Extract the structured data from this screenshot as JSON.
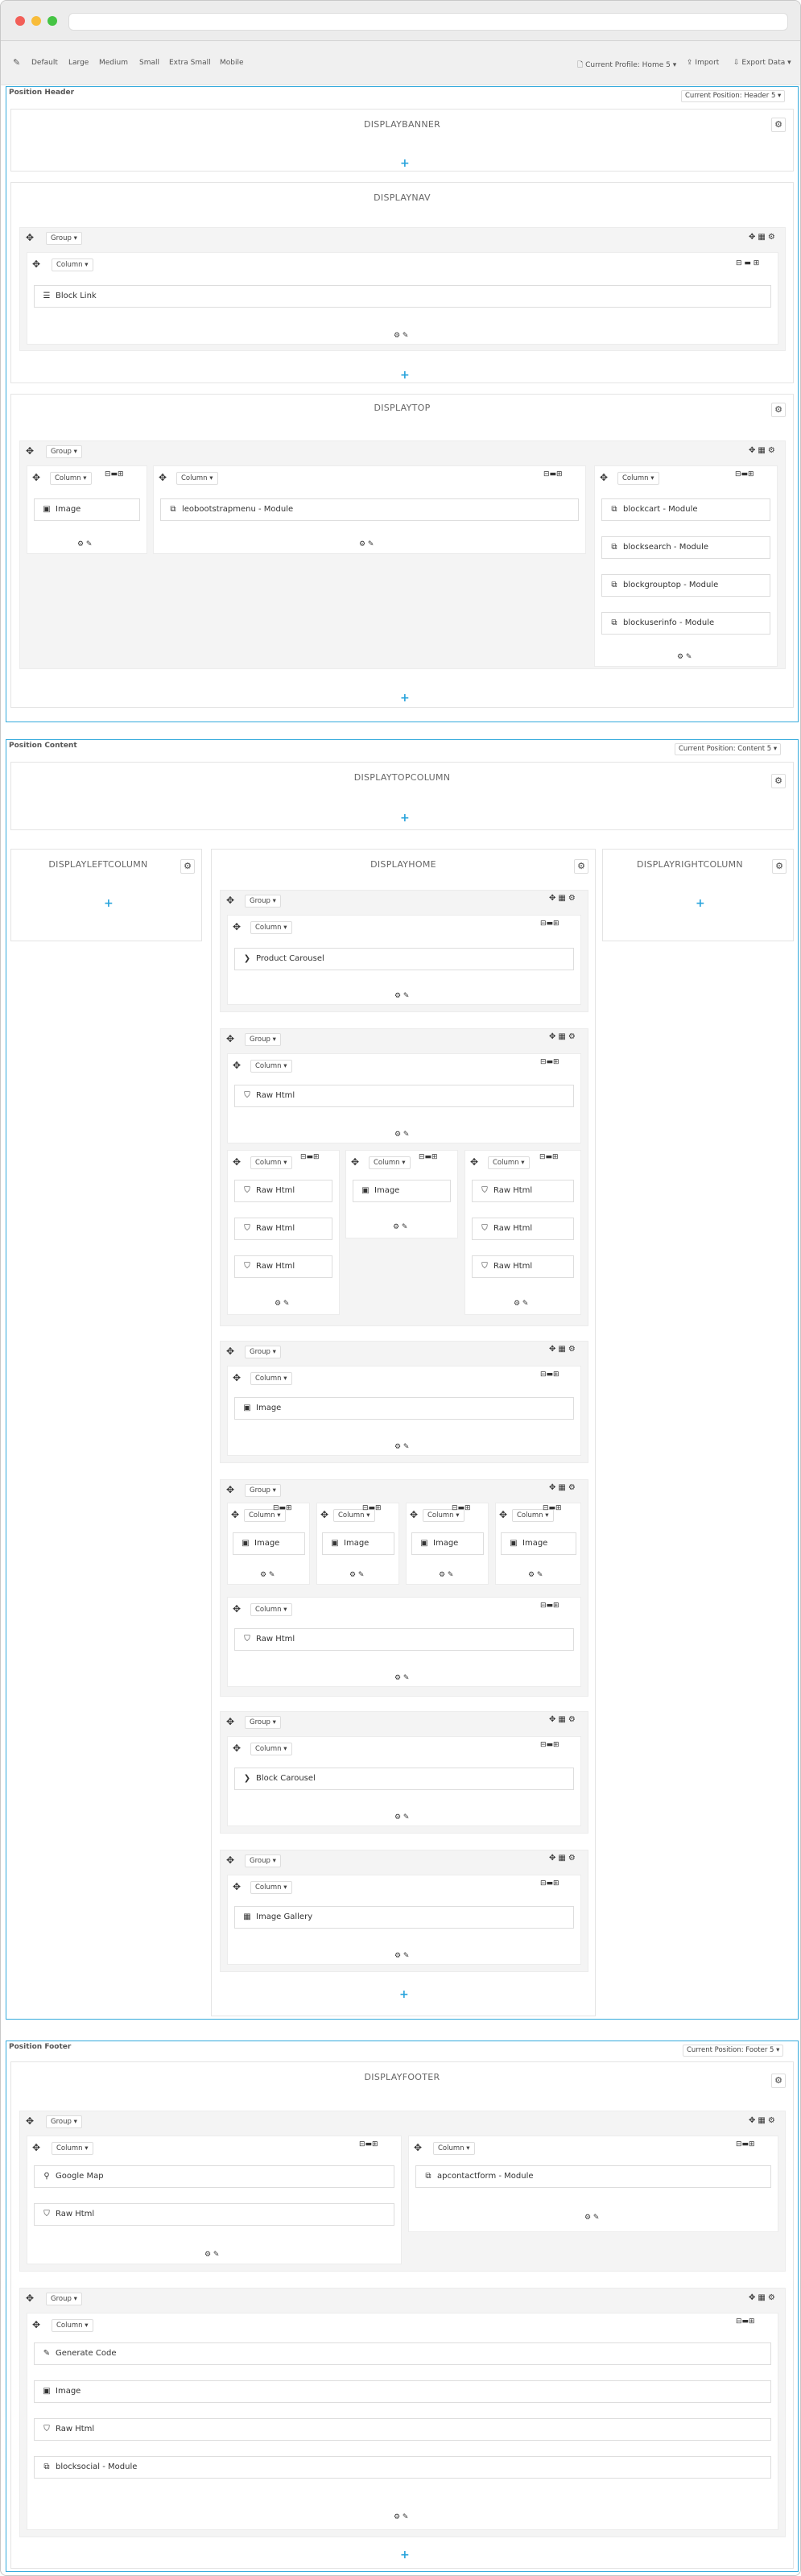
{
  "toolbar": {
    "items": [
      "Default",
      "Large",
      "Medium",
      "Small",
      "Extra Small",
      "Mobile"
    ],
    "profile": "Current Profile: Home 5",
    "import": "Import",
    "export": "Export Data"
  },
  "icons": {
    "wand": "✎",
    "file": "🗋",
    "cloud_up": "⇪",
    "cloud_down": "⇩",
    "move": "✥",
    "gear": "⚙",
    "pencil": "✎",
    "plus": "+",
    "grid": "▦",
    "minus": "⊟",
    "plus_box": "⊞"
  },
  "header": {
    "title": "Position Header",
    "button": "Current Position: Header 5",
    "hooks": {
      "banner": "DISPLAYBANNER",
      "nav": "DISPLAYNAV",
      "top": "DISPLAYTOP"
    }
  },
  "content": {
    "title": "Position Content",
    "button": "Current Position: Content 5",
    "hooks": {
      "topcolumn": "DISPLAYTOPCOLUMN",
      "left": "DISPLAYLEFTCOLUMN",
      "home": "DISPLAYHOME",
      "right": "DISPLAYRIGHTCOLUMN"
    }
  },
  "footer": {
    "title": "Position Footer",
    "button": "Current Position: Footer 5",
    "hooks": {
      "footer": "DISPLAYFOOTER"
    }
  },
  "labels": {
    "group": "Group",
    "column": "Column"
  },
  "blocks": {
    "block_link": "Block Link",
    "image": "Image",
    "leobootstrapmenu": "leobootstrapmenu - Module",
    "blockcart": "blockcart - Module",
    "blocksearch": "blocksearch - Module",
    "blockgrouptop": "blockgrouptop - Module",
    "blockuserinfo": "blockuserinfo - Module",
    "product_carousel": "Product Carousel",
    "raw_html": "Raw Html",
    "block_carousel": "Block Carousel",
    "image_gallery": "Image Gallery",
    "google_map": "Google Map",
    "apcontactform": "apcontactform - Module",
    "generate_code": "Generate Code",
    "blocksocial": "blocksocial - Module"
  }
}
